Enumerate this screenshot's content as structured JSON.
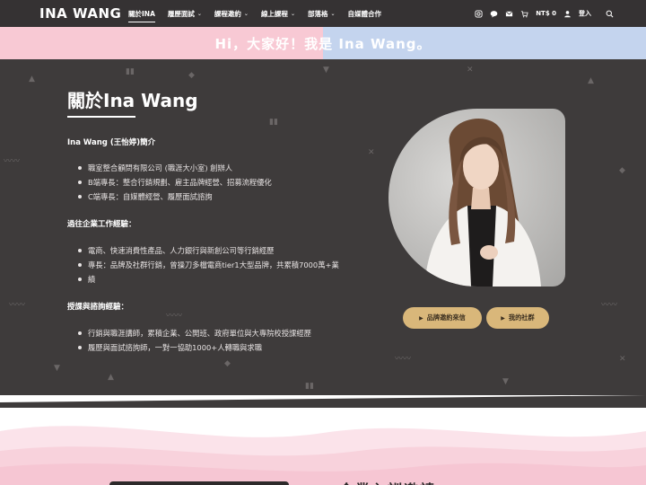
{
  "header": {
    "logo": "INA WANG",
    "nav": [
      {
        "label": "關於INA",
        "active": true,
        "dropdown": false
      },
      {
        "label": "履歷面試",
        "active": false,
        "dropdown": true
      },
      {
        "label": "課程邀約",
        "active": false,
        "dropdown": true
      },
      {
        "label": "線上課程",
        "active": false,
        "dropdown": true
      },
      {
        "label": "部落格",
        "active": false,
        "dropdown": true
      },
      {
        "label": "自媒體合作",
        "active": false,
        "dropdown": false
      }
    ],
    "cart_label": "NT$ 0",
    "login_label": "登入",
    "icons": [
      "instagram-icon",
      "line-icon",
      "mail-icon",
      "cart-icon",
      "user-icon",
      "search-icon"
    ]
  },
  "banner": {
    "text": "Hi，大家好！我是 Ina Wang。",
    "colors": {
      "left": "#f8c9d4",
      "right": "#c4d4ee"
    }
  },
  "about": {
    "title": "關於Ina Wang",
    "intro_heading": "Ina Wang (王怡婷)簡介",
    "intro_items": [
      "職室整合顧問有限公司 (職涯大小室) 創辦人",
      "B端專長：整合行銷規劃、雇主品牌經營、招募流程優化",
      "C端專長：自媒體經營、履歷面試諮詢"
    ],
    "work_heading": "過往企業工作經驗：",
    "work_items": [
      "電商、快速消費性產品、人力銀行與新創公司等行銷經歷",
      "專長：品牌及社群行銷，曾操刀多檔電商tier1大型品牌，共累積7000萬+業",
      "績"
    ],
    "teach_heading": "授課與諮詢經驗：",
    "teach_items": [
      "行銷與職涯講師，累積企業、公開班、政府單位與大專院校授課經歷",
      "履歷與面試諮詢師，一對一協助1000+人轉職與求職"
    ],
    "cta_invite": "品牌邀約來信",
    "cta_community": "我的社群",
    "accent_color": "#d9b77a",
    "background_color": "#3e3b3b"
  },
  "lower": {
    "title_partial": "企業內訓邀請"
  }
}
